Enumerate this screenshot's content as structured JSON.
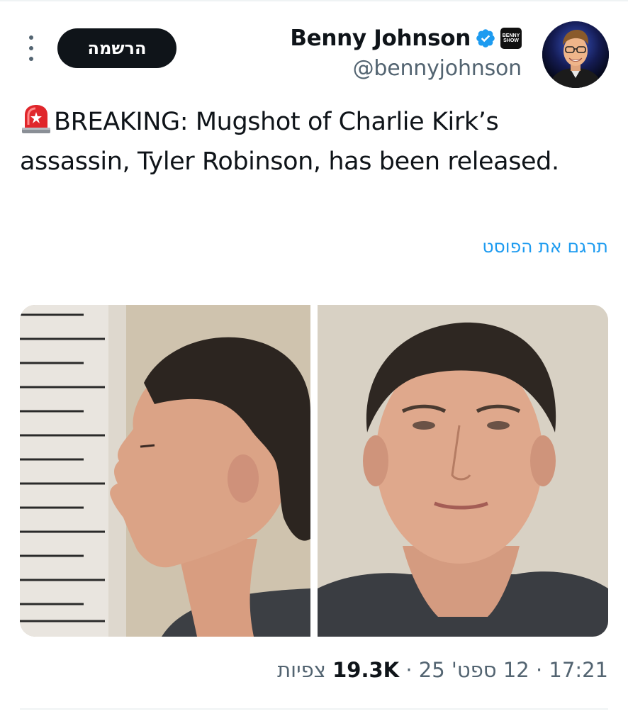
{
  "author": {
    "display_name": "Benny Johnson",
    "handle": "@bennyjohnson",
    "affiliate_badge_text": "BENNY SHOW",
    "verified_icon": "verified-badge-icon",
    "brand_color": "#1d9bf0"
  },
  "header": {
    "register_label": "הרשמה",
    "more_icon": "more-vertical-icon"
  },
  "tweet": {
    "emoji_icon": "police-siren-emoji",
    "text_line": "BREAKING: Mugshot of Charlie Kirk’s assassin, Tyler Robinson, has been released.",
    "translate_label": "תרגם את הפוסט"
  },
  "media": {
    "images": [
      {
        "name": "mugshot-profile"
      },
      {
        "name": "mugshot-front"
      }
    ]
  },
  "meta": {
    "time": "17:21",
    "sep1": " · ",
    "date": "12 ספט' 25",
    "sep2": " · ",
    "views_count": "19.3K",
    "views_label": "צפיות"
  }
}
